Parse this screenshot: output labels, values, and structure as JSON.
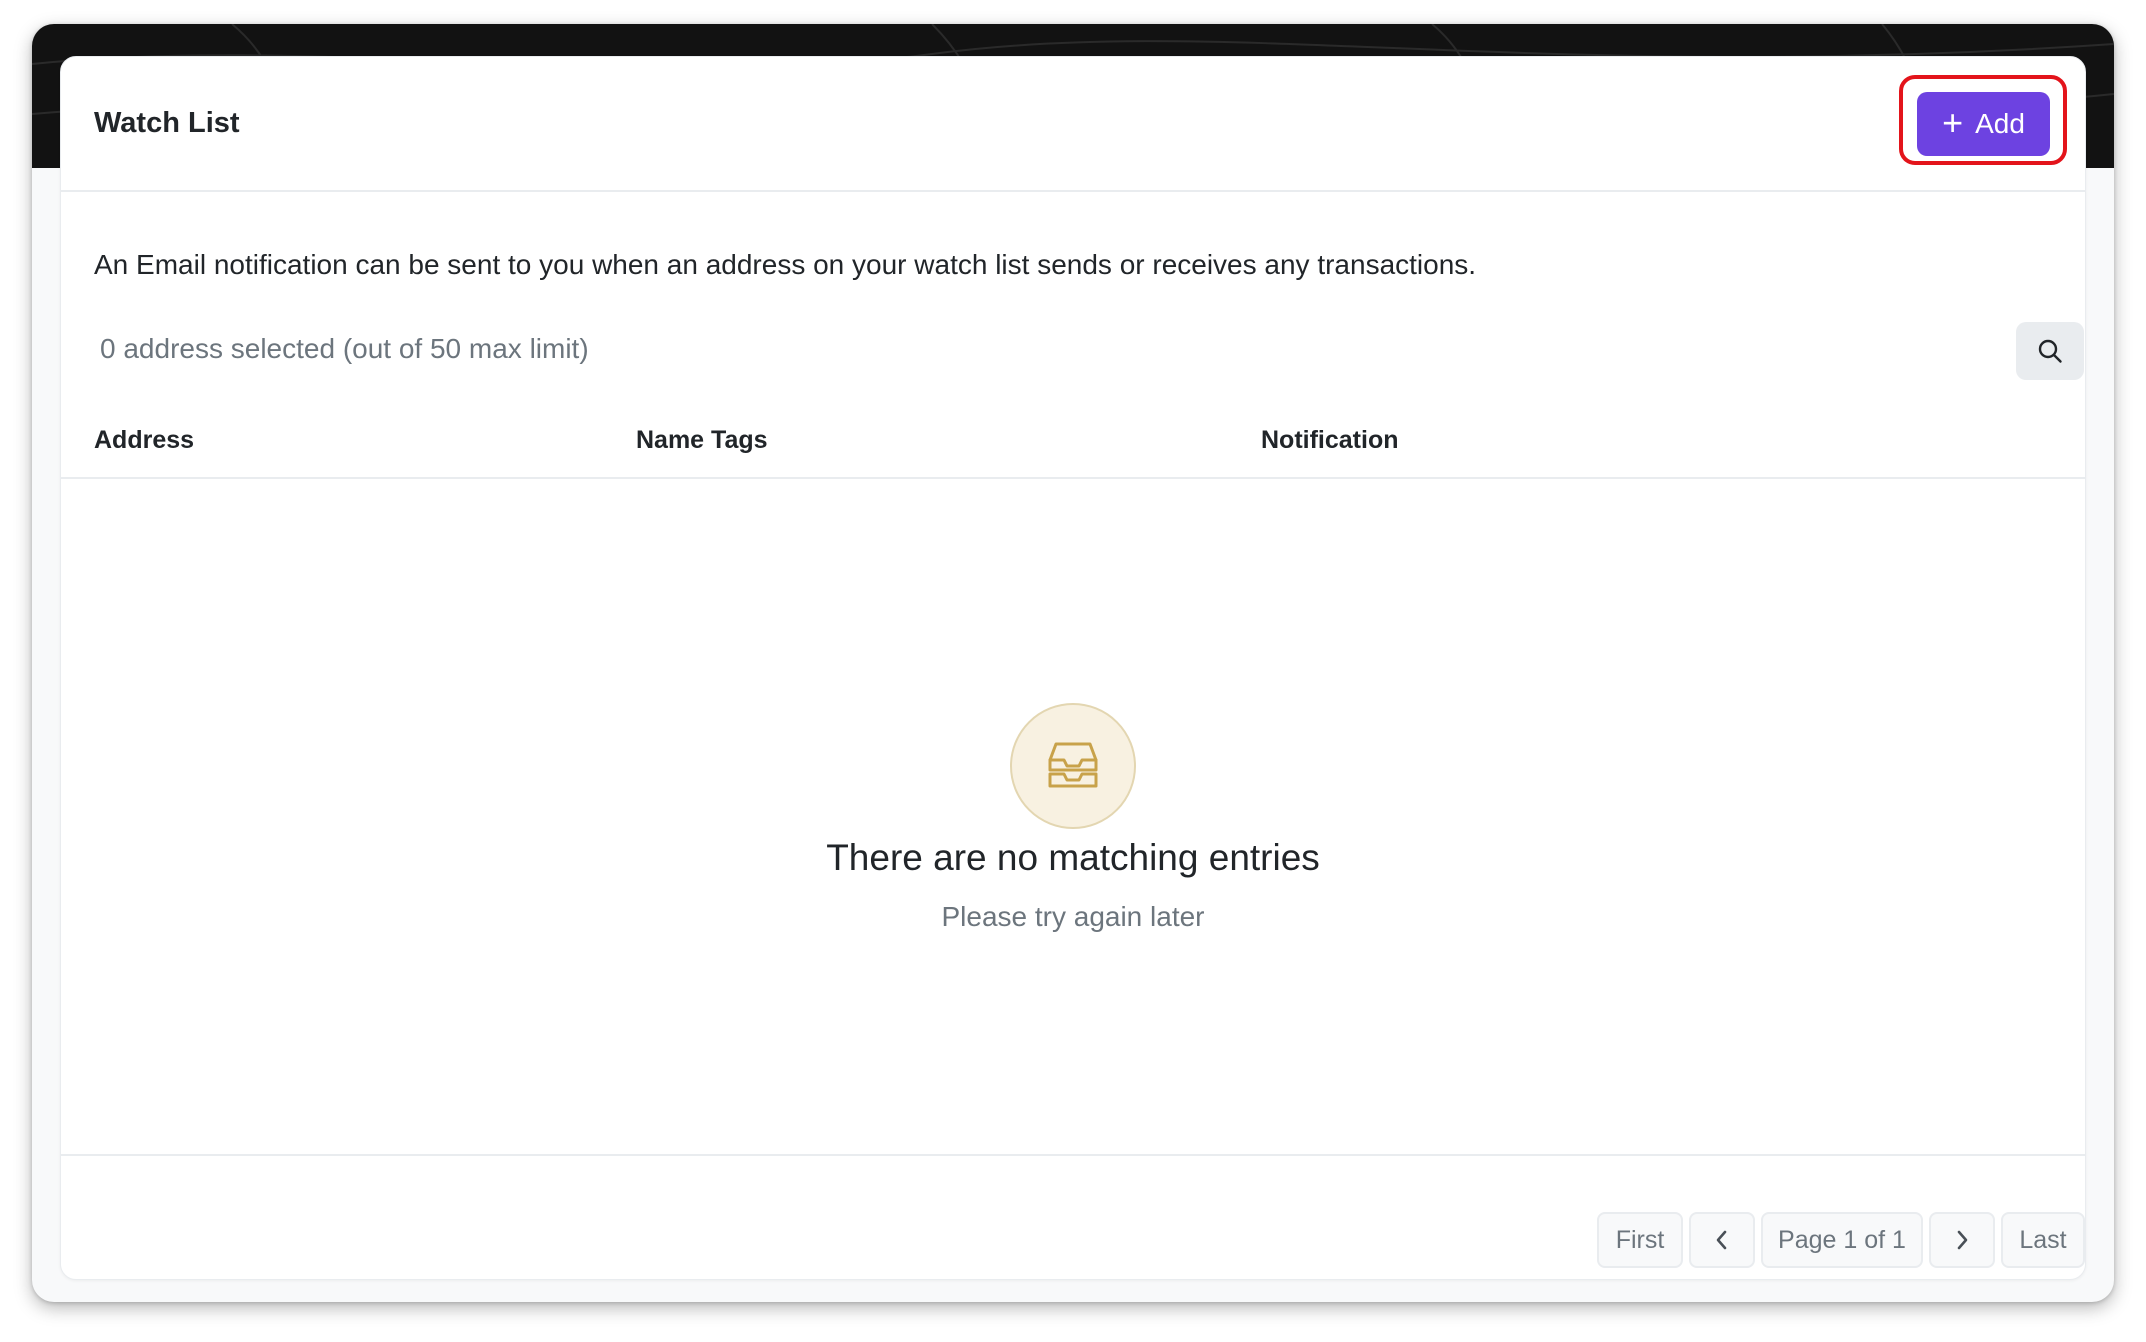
{
  "card": {
    "title": "Watch List",
    "add_label": "Add",
    "notice": "An Email notification can be sent to you when an address on your watch list sends or receives any transactions.",
    "selected_text": "0 address selected (out of 50 max limit)"
  },
  "table": {
    "columns": [
      "Address",
      "Name Tags",
      "Notification"
    ]
  },
  "empty_state": {
    "icon": "inbox-icon",
    "title": "There are no matching entries",
    "subtitle": "Please try again later"
  },
  "pagination": {
    "first": "First",
    "page": "Page 1 of 1",
    "last": "Last"
  },
  "colors": {
    "accent": "#6d42e1",
    "highlight": "#e3141b",
    "empty_icon": "#c8a24a"
  }
}
